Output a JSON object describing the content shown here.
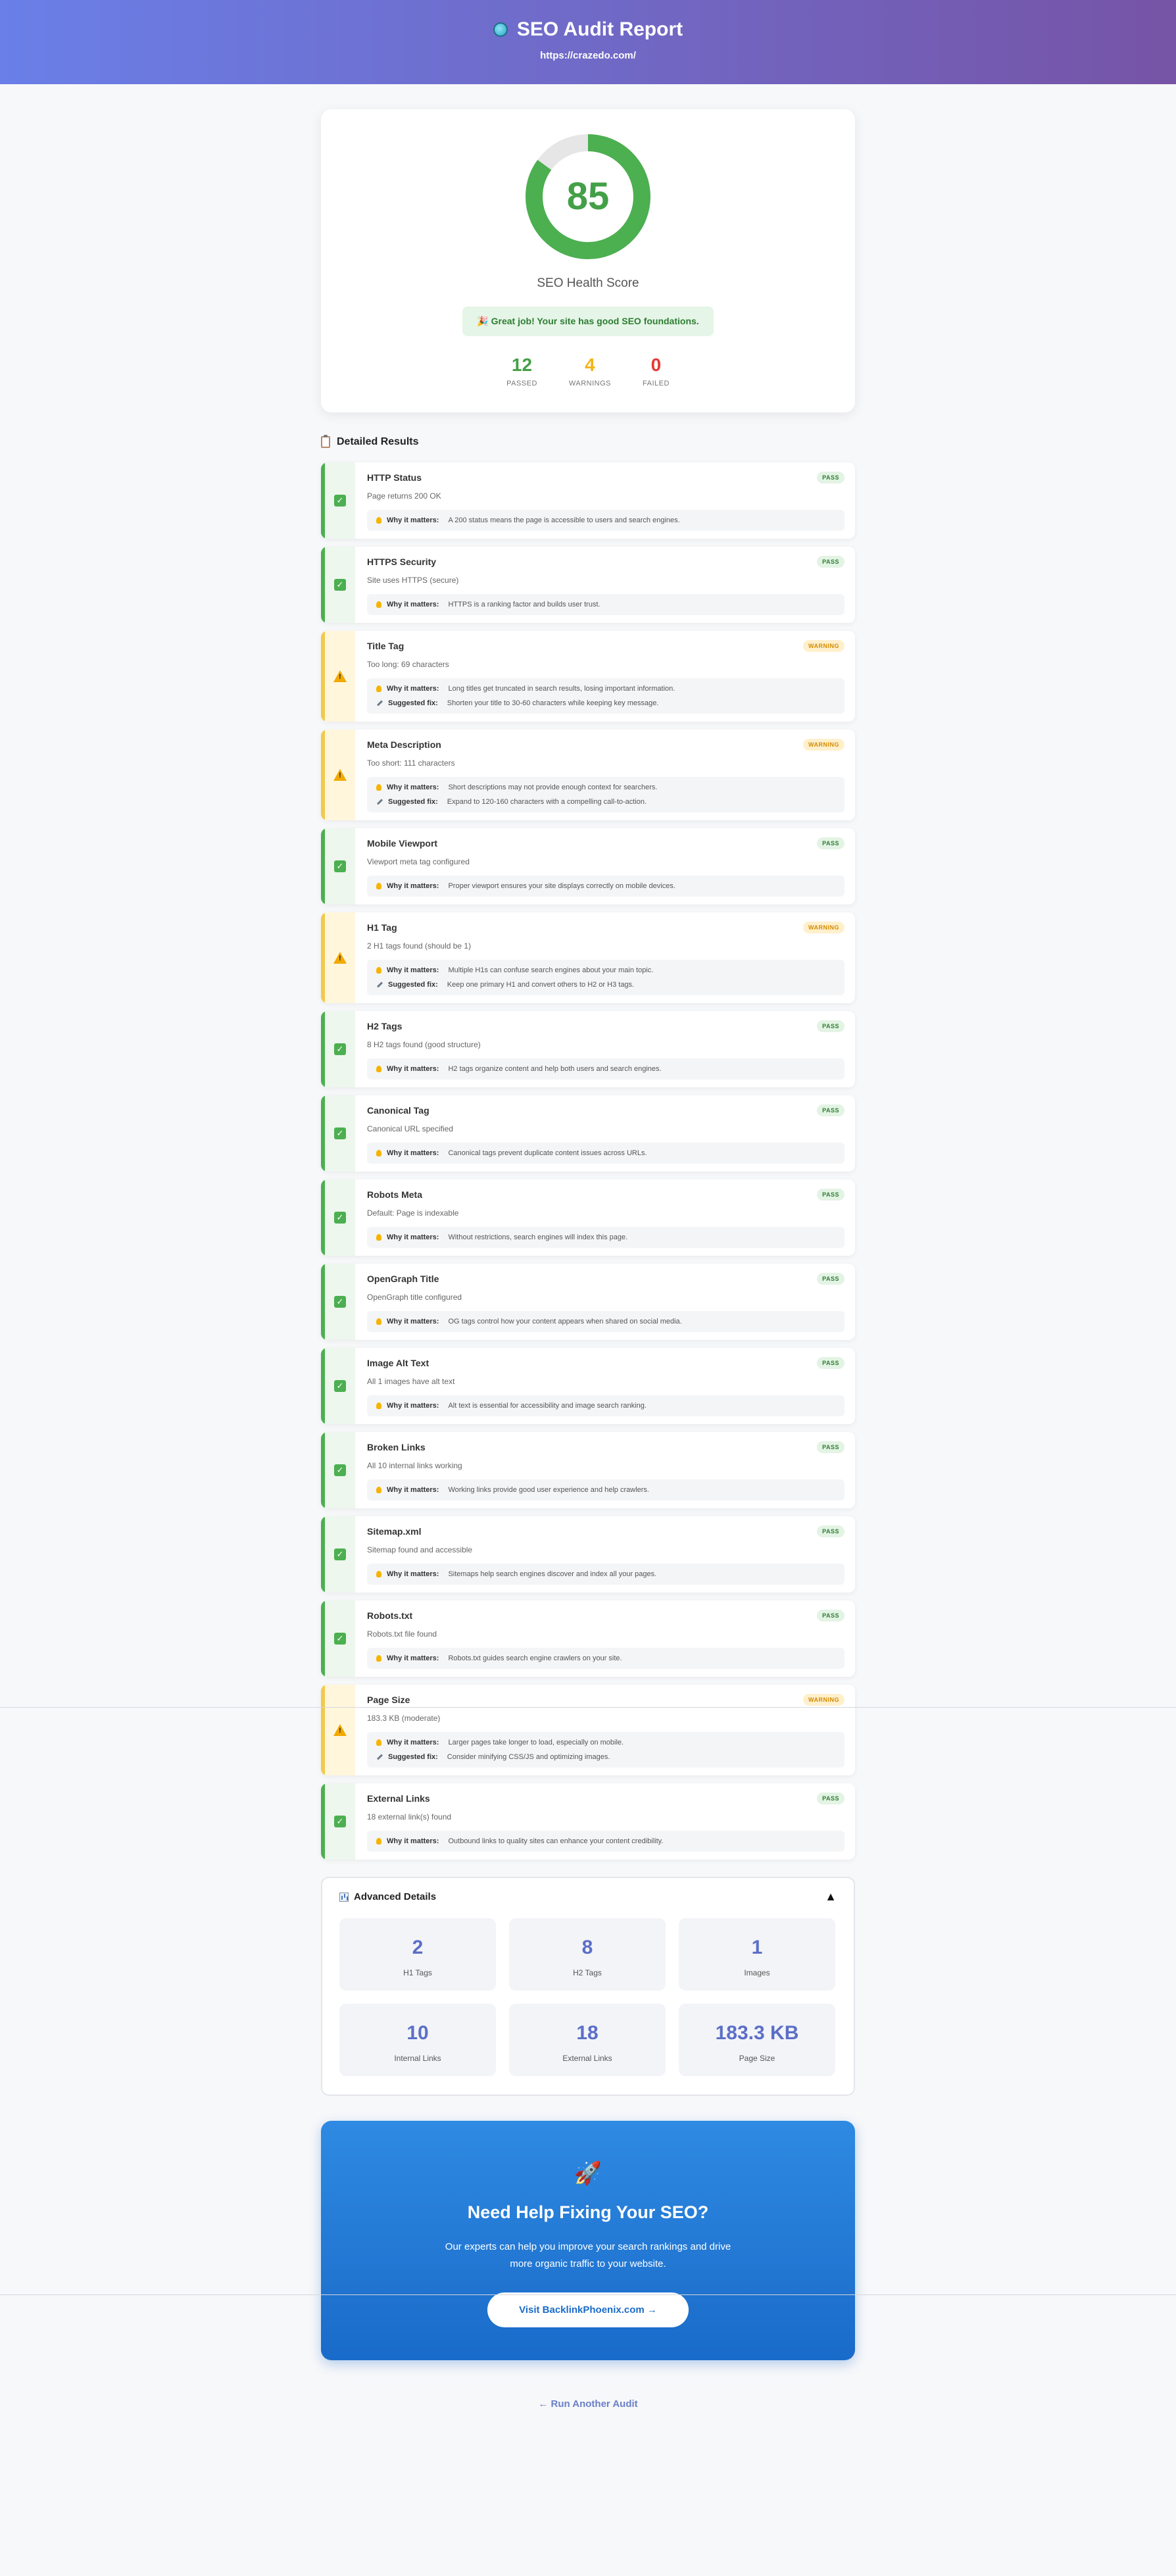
{
  "header": {
    "title": "SEO Audit Report",
    "url": "https://crazedo.com/"
  },
  "score": {
    "value": 85,
    "fraction": 0.85,
    "label": "SEO Health Score",
    "message": "🎉 Great job! Your site has good SEO foundations.",
    "stats": [
      {
        "value": "12",
        "label": "PASSED"
      },
      {
        "value": "4",
        "label": "WARNINGS"
      },
      {
        "value": "0",
        "label": "FAILED"
      }
    ],
    "colors": {
      "pass": "#43a047",
      "warning": "#f2b51a",
      "fail": "#e53935"
    }
  },
  "results_title": "Detailed Results",
  "why_label": "Why it matters:",
  "fix_label": "Suggested fix:",
  "results": [
    {
      "status": "pass",
      "badge": "PASS",
      "title": "HTTP Status",
      "message": "Page returns 200 OK",
      "why": "A 200 status means the page is accessible to users and search engines."
    },
    {
      "status": "pass",
      "badge": "PASS",
      "title": "HTTPS Security",
      "message": "Site uses HTTPS (secure)",
      "why": "HTTPS is a ranking factor and builds user trust."
    },
    {
      "status": "warning",
      "badge": "WARNING",
      "title": "Title Tag",
      "message": "Too long: 69 characters",
      "why": "Long titles get truncated in search results, losing important information.",
      "fix": "Shorten your title to 30-60 characters while keeping key message."
    },
    {
      "status": "warning",
      "badge": "WARNING",
      "title": "Meta Description",
      "message": "Too short: 111 characters",
      "why": "Short descriptions may not provide enough context for searchers.",
      "fix": "Expand to 120-160 characters with a compelling call-to-action."
    },
    {
      "status": "pass",
      "badge": "PASS",
      "title": "Mobile Viewport",
      "message": "Viewport meta tag configured",
      "why": "Proper viewport ensures your site displays correctly on mobile devices."
    },
    {
      "status": "warning",
      "badge": "WARNING",
      "title": "H1 Tag",
      "message": "2 H1 tags found (should be 1)",
      "why": "Multiple H1s can confuse search engines about your main topic.",
      "fix": "Keep one primary H1 and convert others to H2 or H3 tags."
    },
    {
      "status": "pass",
      "badge": "PASS",
      "title": "H2 Tags",
      "message": "8 H2 tags found (good structure)",
      "why": "H2 tags organize content and help both users and search engines."
    },
    {
      "status": "pass",
      "badge": "PASS",
      "title": "Canonical Tag",
      "message": "Canonical URL specified",
      "why": "Canonical tags prevent duplicate content issues across URLs."
    },
    {
      "status": "pass",
      "badge": "PASS",
      "title": "Robots Meta",
      "message": "Default: Page is indexable",
      "why": "Without restrictions, search engines will index this page."
    },
    {
      "status": "pass",
      "badge": "PASS",
      "title": "OpenGraph Title",
      "message": "OpenGraph title configured",
      "why": "OG tags control how your content appears when shared on social media."
    },
    {
      "status": "pass",
      "badge": "PASS",
      "title": "Image Alt Text",
      "message": "All 1 images have alt text",
      "why": "Alt text is essential for accessibility and image search ranking."
    },
    {
      "status": "pass",
      "badge": "PASS",
      "title": "Broken Links",
      "message": "All 10 internal links working",
      "why": "Working links provide good user experience and help crawlers."
    },
    {
      "status": "pass",
      "badge": "PASS",
      "title": "Sitemap.xml",
      "message": "Sitemap found and accessible",
      "why": "Sitemaps help search engines discover and index all your pages."
    },
    {
      "status": "pass",
      "badge": "PASS",
      "title": "Robots.txt",
      "message": "Robots.txt file found",
      "why": "Robots.txt guides search engine crawlers on your site."
    },
    {
      "status": "warning",
      "badge": "WARNING",
      "title": "Page Size",
      "message": "183.3 KB (moderate)",
      "why": "Larger pages take longer to load, especially on mobile.",
      "fix": "Consider minifying CSS/JS and optimizing images."
    },
    {
      "status": "pass",
      "badge": "PASS",
      "title": "External Links",
      "message": "18 external link(s) found",
      "why": "Outbound links to quality sites can enhance your content credibility."
    }
  ],
  "advanced": {
    "title": "Advanced Details",
    "toggle": "▲",
    "cells": [
      {
        "value": "2",
        "label": "H1 Tags"
      },
      {
        "value": "8",
        "label": "H2 Tags"
      },
      {
        "value": "1",
        "label": "Images"
      },
      {
        "value": "10",
        "label": "Internal Links"
      },
      {
        "value": "18",
        "label": "External Links"
      },
      {
        "value": "183.3 KB",
        "label": "Page Size"
      }
    ]
  },
  "cta": {
    "icon": "🚀",
    "title": "Need Help Fixing Your SEO?",
    "text": "Our experts can help you improve your search rankings and drive more organic traffic to your website.",
    "button": "Visit BacklinkPhoenix.com →"
  },
  "run_again": "← Run Another Audit"
}
